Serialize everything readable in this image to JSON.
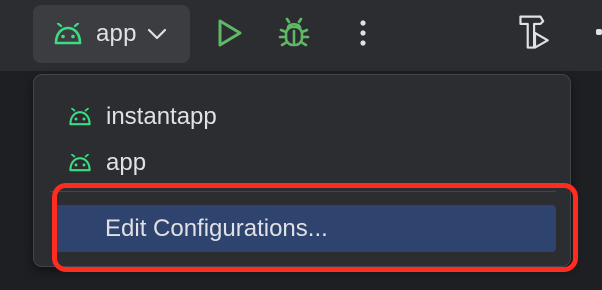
{
  "toolbar": {
    "config_selector": {
      "selected": "app",
      "icon": "android-icon"
    },
    "buttons": [
      {
        "name": "run-button",
        "icon": "run-icon"
      },
      {
        "name": "debug-button",
        "icon": "bug-icon"
      },
      {
        "name": "more-button",
        "icon": "more-vertical-icon"
      },
      {
        "name": "build-run-button",
        "icon": "hammer-run-icon"
      }
    ]
  },
  "dropdown": {
    "items": [
      {
        "label": "instantapp",
        "icon": "android-icon"
      },
      {
        "label": "app",
        "icon": "android-icon"
      }
    ],
    "edit_label": "Edit Configurations..."
  },
  "colors": {
    "android_green": "#3ddc84",
    "run_green": "#5fb865",
    "selection": "#2e436e",
    "highlight": "#ff2d20"
  }
}
